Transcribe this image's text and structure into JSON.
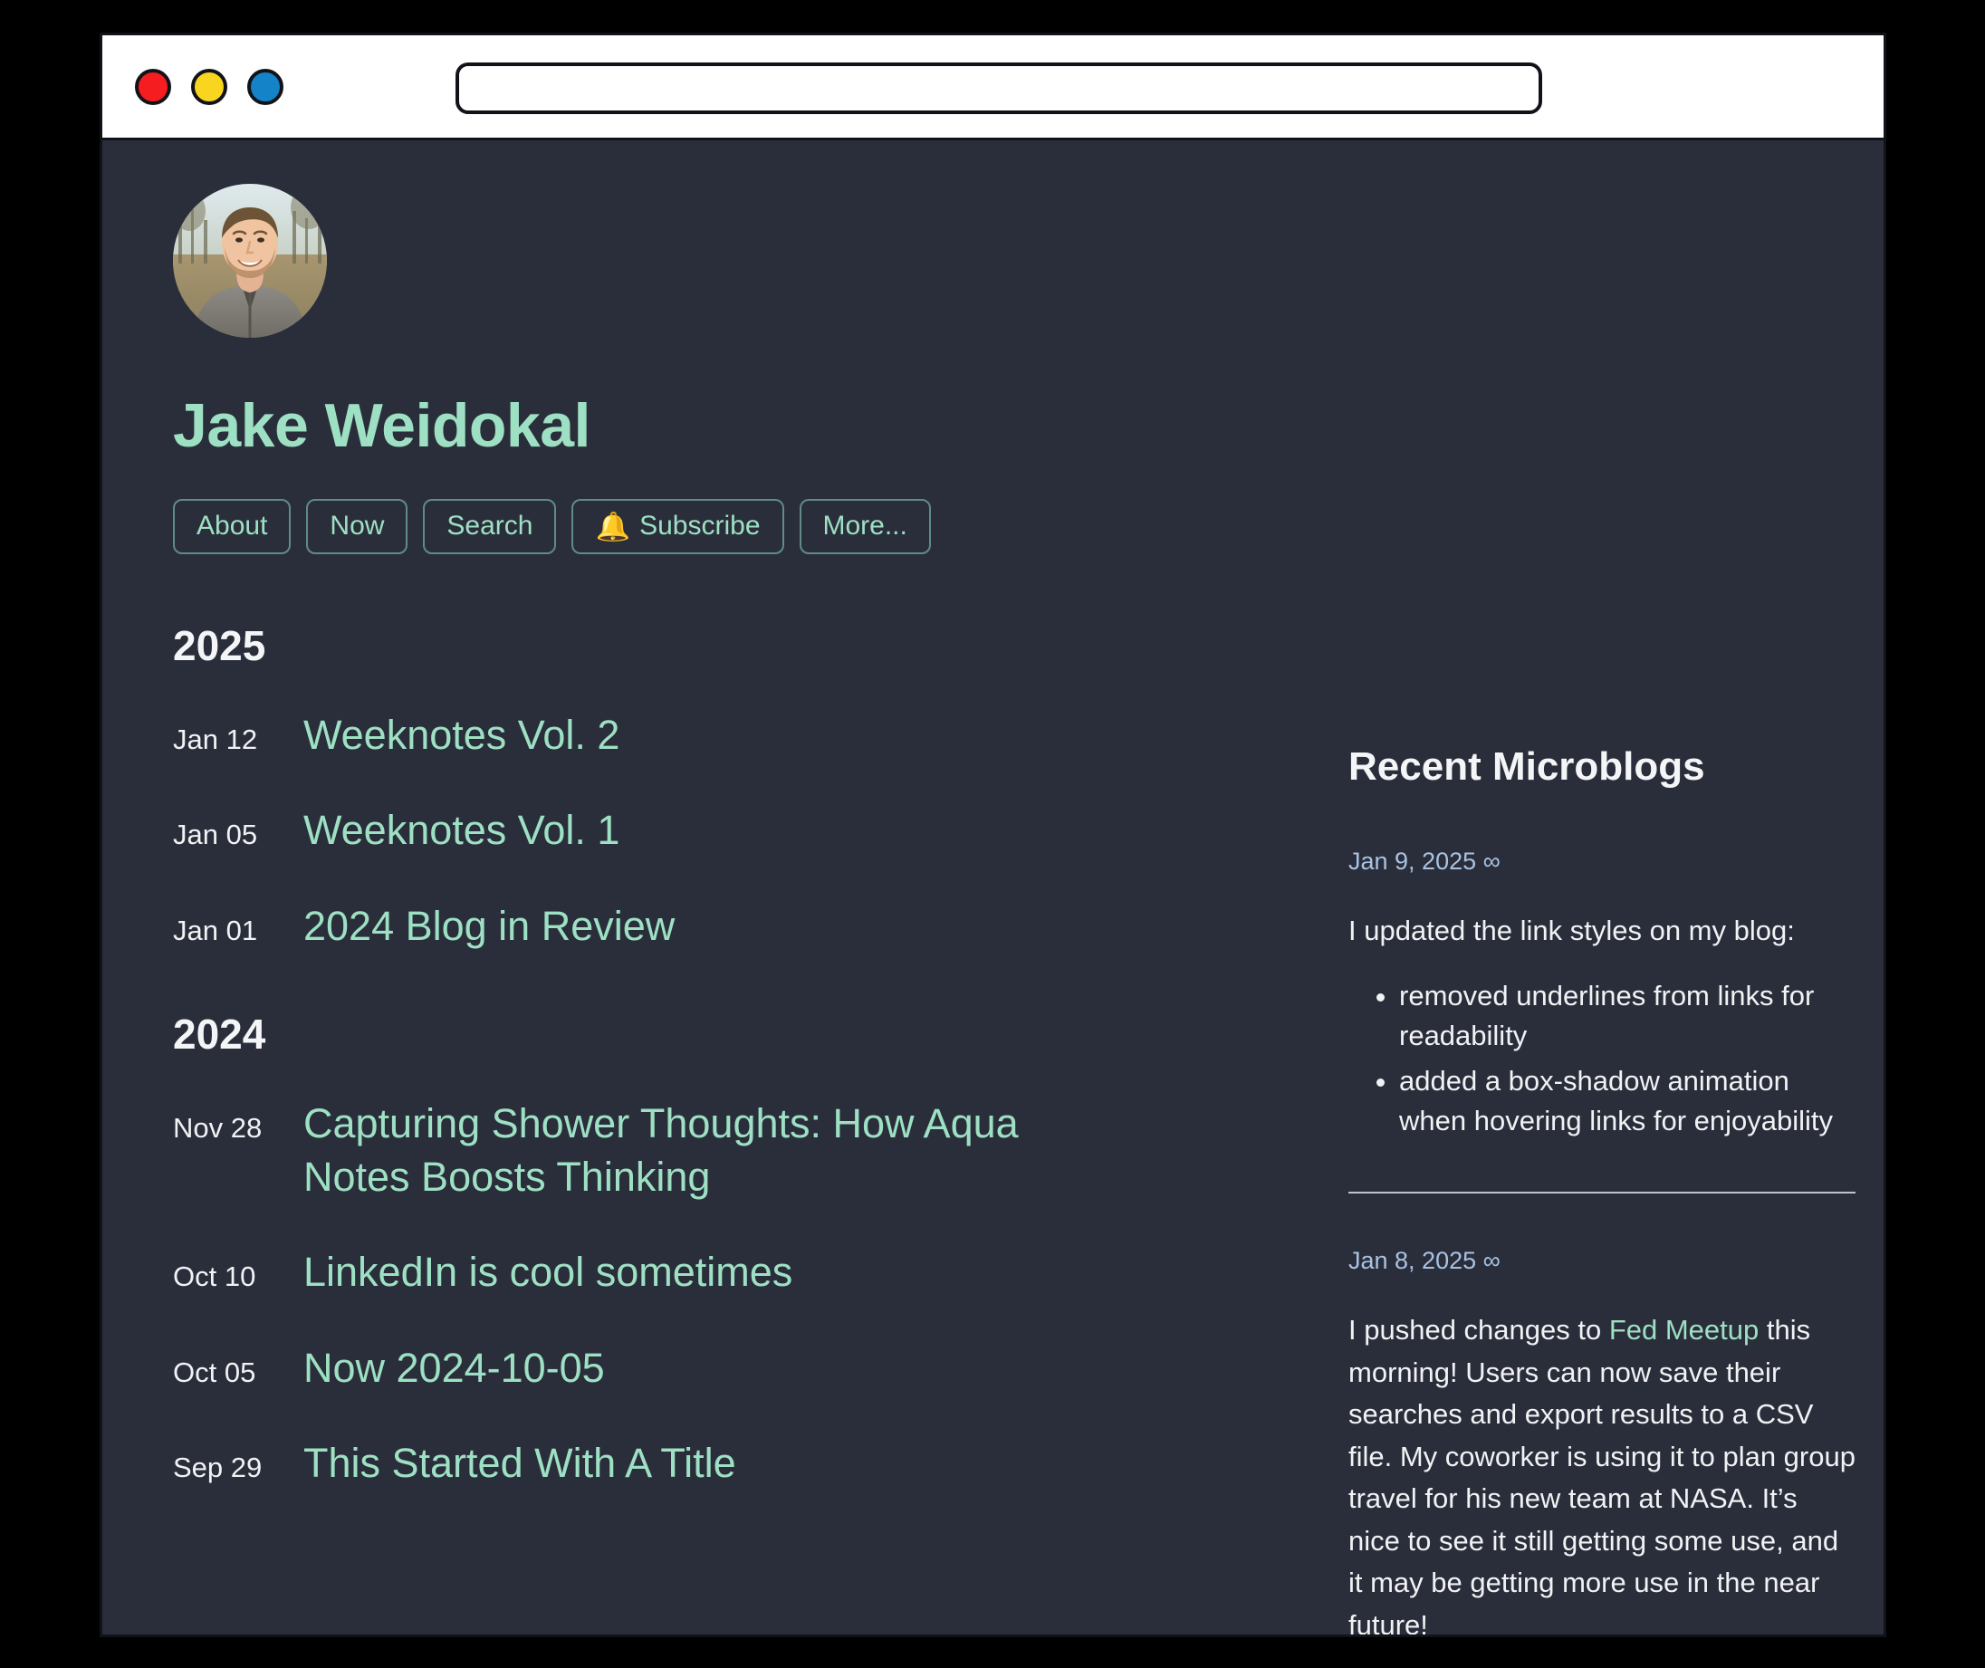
{
  "browser": {
    "traffic_lights": [
      "close-red",
      "minimize-yellow",
      "maximize-blue"
    ],
    "url_value": "",
    "url_placeholder": ""
  },
  "profile": {
    "avatar_alt": "Jake Weidokal profile photo",
    "name": "Jake Weidokal"
  },
  "nav": {
    "items": [
      {
        "label": "About",
        "icon": ""
      },
      {
        "label": "Now",
        "icon": ""
      },
      {
        "label": "Search",
        "icon": ""
      },
      {
        "label": "Subscribe",
        "icon": "🔔"
      },
      {
        "label": "More...",
        "icon": ""
      }
    ]
  },
  "archive": [
    {
      "year": "2025",
      "posts": [
        {
          "date": "Jan 12",
          "title": "Weeknotes Vol. 2"
        },
        {
          "date": "Jan 05",
          "title": "Weeknotes Vol. 1"
        },
        {
          "date": "Jan 01",
          "title": "2024 Blog in Review"
        }
      ]
    },
    {
      "year": "2024",
      "posts": [
        {
          "date": "Nov 28",
          "title": "Capturing Shower Thoughts: How Aqua Notes Boosts Thinking"
        },
        {
          "date": "Oct 10",
          "title": "LinkedIn is cool sometimes"
        },
        {
          "date": "Oct 05",
          "title": "Now 2024-10-05"
        },
        {
          "date": "Sep 29",
          "title": "This Started With A Title"
        }
      ]
    }
  ],
  "sidebar": {
    "heading": "Recent Microblogs",
    "entries": [
      {
        "date": "Jan 9, 2025 ∞",
        "body": "I updated the link styles on my blog:",
        "bullets": [
          "removed underlines from links for readability",
          "added a box-shadow animation when hovering links for enjoyability"
        ]
      },
      {
        "date": "Jan 8, 2025 ∞",
        "body_before": "I pushed changes to ",
        "body_link": "Fed Meetup",
        "body_after": " this morning! Users can now save their searches and export results to a CSV file. My coworker is using it to plan group travel for his new team at NASA. It’s nice to see it still getting some use, and it may be getting more use in the near future!",
        "bullets": []
      }
    ]
  },
  "colors": {
    "page_background": "#2a2e3b",
    "accent_mint": "#9ee0c3",
    "text_primary": "#f1f2f4",
    "link_blue": "#a9c2e2",
    "button_border": "#5f8c85",
    "chrome_white": "#ffffff",
    "frame_black": "#111318"
  }
}
